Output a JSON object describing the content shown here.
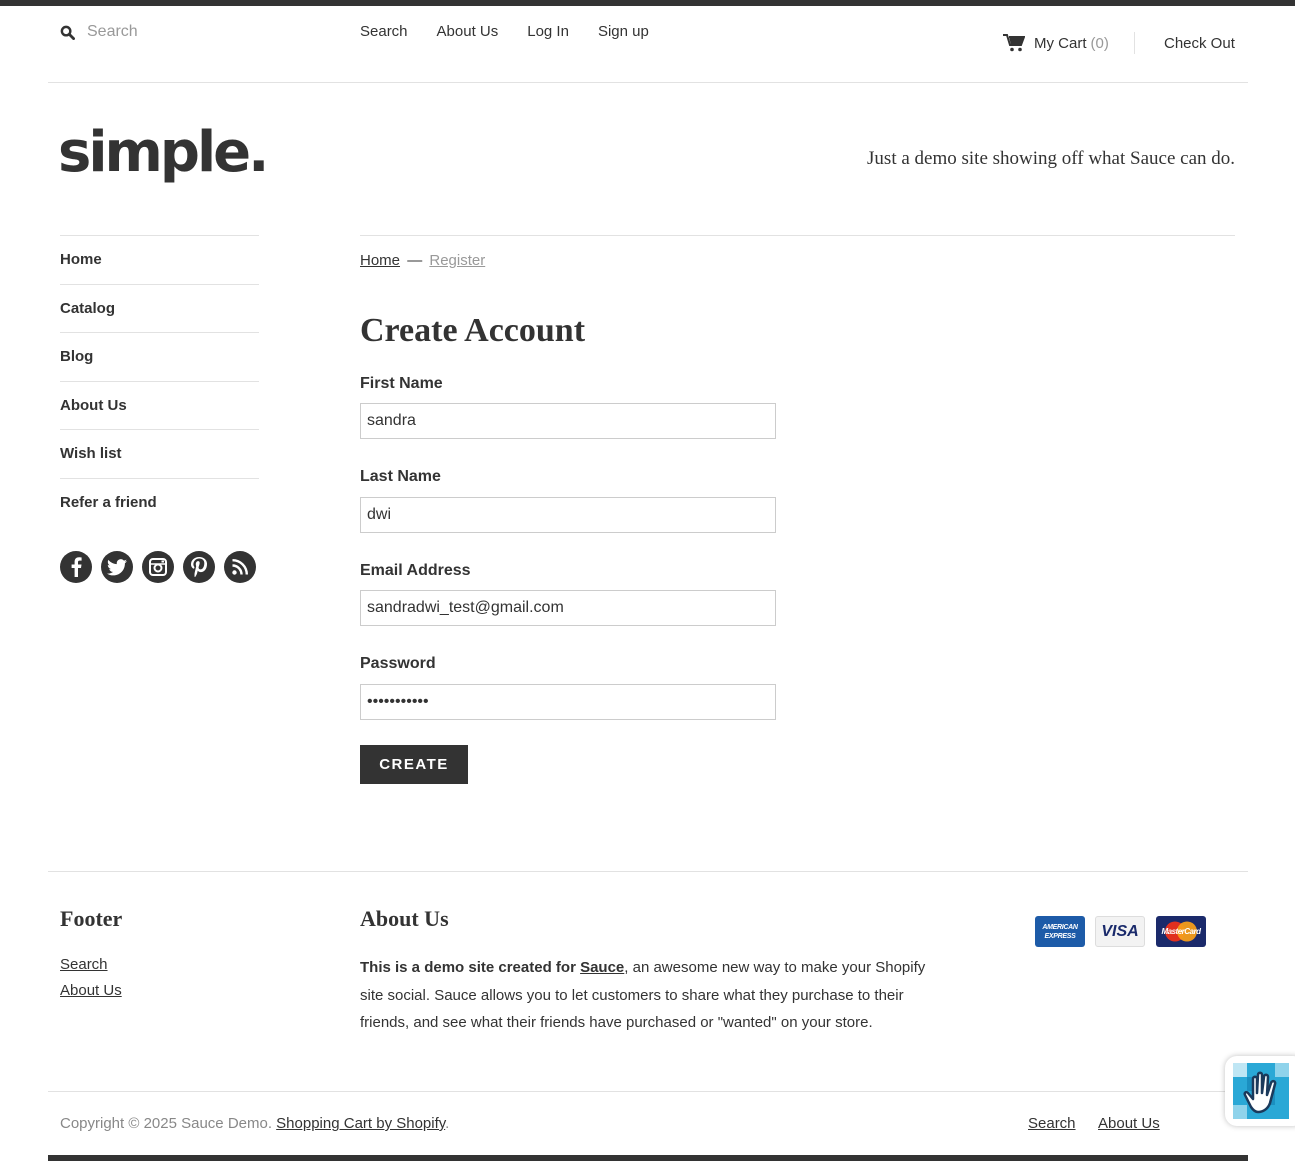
{
  "search": {
    "placeholder": "Search"
  },
  "topnav": {
    "items": [
      "Search",
      "About Us",
      "Log In",
      "Sign up"
    ]
  },
  "cart": {
    "label": "My Cart",
    "count": "(0)",
    "checkout": "Check Out"
  },
  "logo": "simple.",
  "tagline": "Just a demo site showing off what Sauce can do.",
  "sidebar": {
    "items": [
      "Home",
      "Catalog",
      "Blog",
      "About Us",
      "Wish list",
      "Refer a friend"
    ]
  },
  "social": [
    "facebook-icon",
    "twitter-icon",
    "instagram-icon",
    "pinterest-icon",
    "rss-icon"
  ],
  "breadcrumb": {
    "home": "Home",
    "separator": "—",
    "current": "Register"
  },
  "form": {
    "title": "Create Account",
    "first_name": {
      "label": "First Name",
      "value": "sandra"
    },
    "last_name": {
      "label": "Last Name",
      "value": "dwi"
    },
    "email": {
      "label": "Email Address",
      "value": "sandradwi_test@gmail.com"
    },
    "password": {
      "label": "Password",
      "value": "dwipassword"
    },
    "submit": "CREATE"
  },
  "footer": {
    "col1": {
      "heading": "Footer",
      "links": [
        "Search",
        "About Us"
      ]
    },
    "col2": {
      "heading": "About Us",
      "intro_bold": "This is a demo site created for",
      "sauce_link": "Sauce",
      "text": ", an awesome new way to make your Shopify site social. Sauce allows you to let customers to share what they purchase to their friends, and see what their friends have purchased or \"wanted\" on your store."
    },
    "cards": [
      "AMERICAN EXPRESS",
      "VISA",
      "MasterCard"
    ],
    "copyright": "Copyright © 2025 Sauce Demo.",
    "shopify_link": "Shopping Cart by Shopify",
    "bottom_links": [
      "Search",
      "About Us"
    ]
  },
  "colors": {
    "dark": "#333333",
    "muted": "#999999",
    "border": "#e2e2e2",
    "amex": "#1d5ba8",
    "mastercard": "#1b2a6b"
  }
}
